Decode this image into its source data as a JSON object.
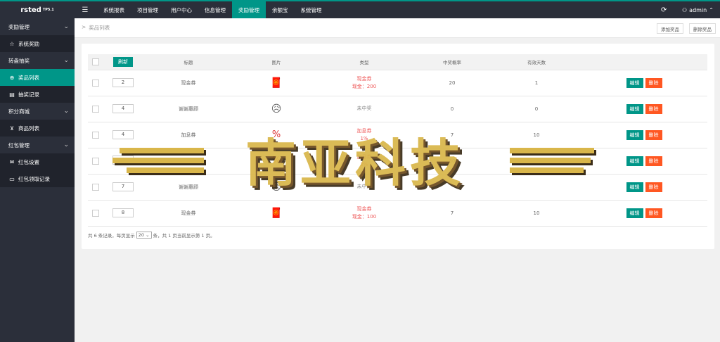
{
  "brand": {
    "name": "rsted",
    "tag": "TP5.1"
  },
  "topnav": {
    "menu_icon": "menu-icon",
    "items": [
      "系统报表",
      "项目管理",
      "用户中心",
      "信息管理",
      "奖励管理",
      "余额宝",
      "系统管理"
    ],
    "active_index": 4,
    "refresh_icon": "refresh-icon",
    "user": "admin",
    "user_icon": "user-icon"
  },
  "sidebar": {
    "groups": [
      {
        "label": "奖励管理",
        "items": [
          {
            "label": "系统奖励",
            "icon": "star-icon"
          }
        ]
      },
      {
        "label": "转盘抽奖",
        "items": [
          {
            "label": "奖品列表",
            "icon": "plus-circle-icon",
            "active": true
          },
          {
            "label": "抽奖记录",
            "icon": "record-icon"
          }
        ]
      },
      {
        "label": "积分商城",
        "items": [
          {
            "label": "商品列表",
            "icon": "cart-icon"
          }
        ]
      },
      {
        "label": "红包管理",
        "items": [
          {
            "label": "红包设置",
            "icon": "envelope-icon"
          },
          {
            "label": "红包领取记录",
            "icon": "ticket-icon"
          }
        ]
      }
    ]
  },
  "breadcrumb": {
    "separator": ">",
    "current": "奖品列表"
  },
  "header_buttons": {
    "add": "添加奖品",
    "delete": "删除奖品"
  },
  "table": {
    "refresh_label": "刷新",
    "columns": [
      "标题",
      "图片",
      "类型",
      "中奖概率",
      "有效天数"
    ],
    "rows": [
      {
        "sort": "2",
        "title": "现金券",
        "image": "red-envelope-icon",
        "type": "现金券",
        "type_detail": "现金：200",
        "prob": "20",
        "days": "1"
      },
      {
        "sort": "4",
        "title": "谢谢惠顾",
        "image": "sad-face-icon",
        "type": "未中奖",
        "type_detail": "",
        "prob": "0",
        "days": "0"
      },
      {
        "sort": "4",
        "title": "加息券",
        "image": "coupon-icon",
        "type": "加息券",
        "type_detail": "1%",
        "prob": "7",
        "days": "10"
      },
      {
        "sort": "",
        "title": "加息券",
        "image": "coupon-icon",
        "type": "加息券",
        "type_detail": "2%",
        "prob": "30",
        "days": ""
      },
      {
        "sort": "7",
        "title": "谢谢惠顾",
        "image": "sad-face-icon",
        "type": "未中奖",
        "type_detail": "",
        "prob": "",
        "days": ""
      },
      {
        "sort": "8",
        "title": "现金券",
        "image": "red-envelope-icon",
        "type": "现金券",
        "type_detail": "现金：100",
        "prob": "7",
        "days": "10"
      }
    ],
    "edit_label": "编辑",
    "delete_label": "删除"
  },
  "pager": {
    "prefix": "共 6 条记录，每页显示",
    "per_page": "20",
    "suffix": "条，共 1 页当前显示第 1 页。"
  },
  "watermark": {
    "text": "南亚科技"
  },
  "colors": {
    "accent": "#009688",
    "danger": "#ff5722",
    "sidebar": "#2b2f3a",
    "watermark_gold": "#d9b64a"
  }
}
